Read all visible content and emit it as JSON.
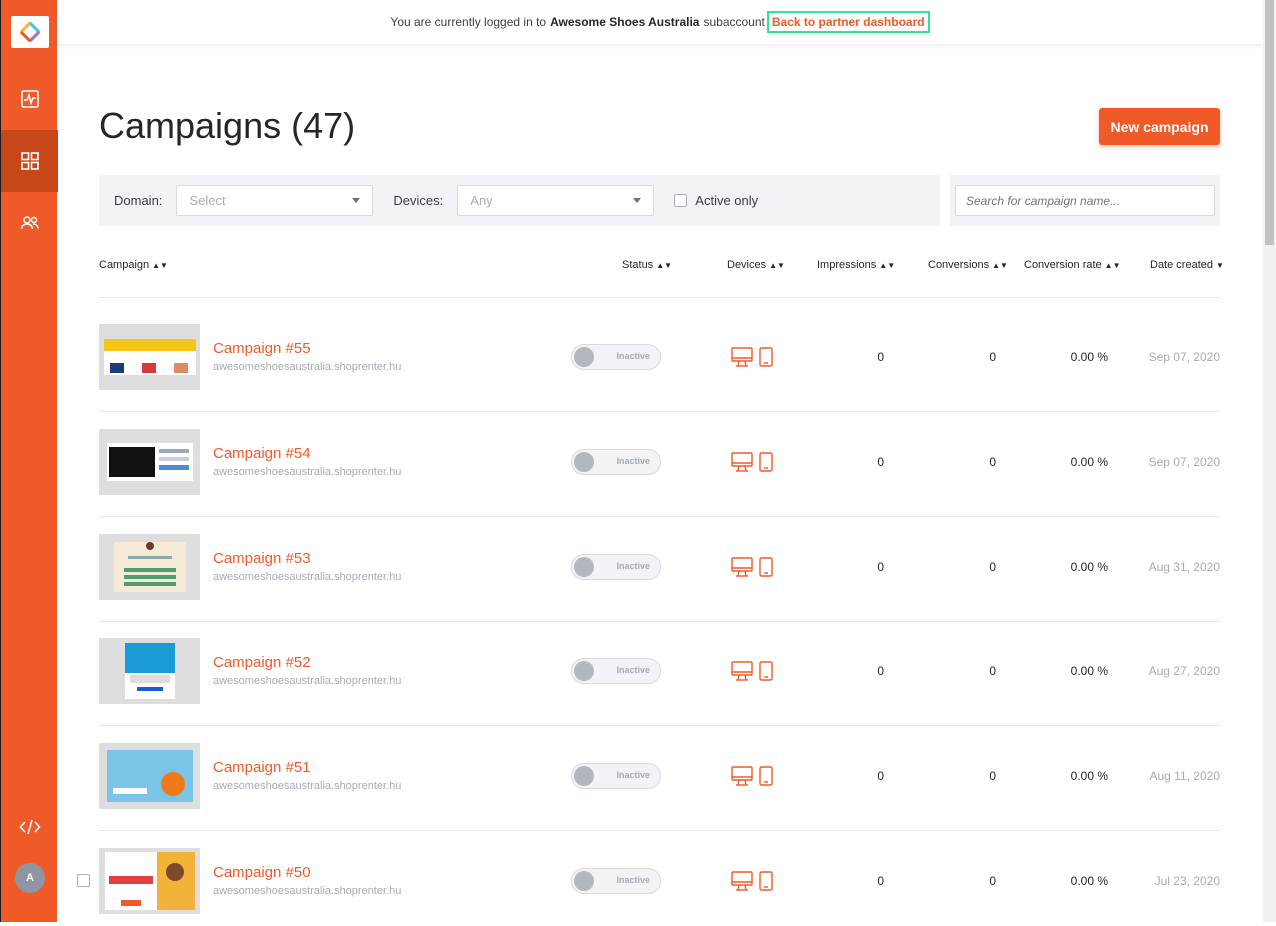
{
  "colors": {
    "accent": "#ef5a28",
    "highlight": "#2fe58f"
  },
  "topbar": {
    "prefix": "You are currently logged in to",
    "account": "Awesome Shoes Australia",
    "suffix": "subaccount",
    "back_link": "Back to partner dashboard"
  },
  "sidebar": {
    "items": [
      {
        "icon": "analytics-icon"
      },
      {
        "icon": "campaigns-grid-icon",
        "active": true
      },
      {
        "icon": "users-icon"
      }
    ],
    "code_icon": "code-icon",
    "avatar_initial": "A"
  },
  "page": {
    "title": "Campaigns (47)",
    "new_button": "New campaign"
  },
  "filters": {
    "domain_label": "Domain:",
    "domain_value": "Select",
    "devices_label": "Devices:",
    "devices_value": "Any",
    "active_only": "Active only",
    "search_placeholder": "Search for campaign name..."
  },
  "columns": {
    "campaign": "Campaign",
    "status": "Status",
    "devices": "Devices",
    "impressions": "Impressions",
    "conversions": "Conversions",
    "conversion_rate": "Conversion rate",
    "date_created": "Date created"
  },
  "rows": [
    {
      "name": "Campaign #55",
      "domain": "awesomeshoesaustralia.shoprenter.hu",
      "status": "Inactive",
      "impressions": "0",
      "conversions": "0",
      "rate": "0.00 %",
      "date": "Sep 07, 2020"
    },
    {
      "name": "Campaign #54",
      "domain": "awesomeshoesaustralia.shoprenter.hu",
      "status": "Inactive",
      "impressions": "0",
      "conversions": "0",
      "rate": "0.00 %",
      "date": "Sep 07, 2020"
    },
    {
      "name": "Campaign #53",
      "domain": "awesomeshoesaustralia.shoprenter.hu",
      "status": "Inactive",
      "impressions": "0",
      "conversions": "0",
      "rate": "0.00 %",
      "date": "Aug 31, 2020"
    },
    {
      "name": "Campaign #52",
      "domain": "awesomeshoesaustralia.shoprenter.hu",
      "status": "Inactive",
      "impressions": "0",
      "conversions": "0",
      "rate": "0.00 %",
      "date": "Aug 27, 2020"
    },
    {
      "name": "Campaign #51",
      "domain": "awesomeshoesaustralia.shoprenter.hu",
      "status": "Inactive",
      "impressions": "0",
      "conversions": "0",
      "rate": "0.00 %",
      "date": "Aug 11, 2020"
    },
    {
      "name": "Campaign #50",
      "domain": "awesomeshoesaustralia.shoprenter.hu",
      "status": "Inactive",
      "impressions": "0",
      "conversions": "0",
      "rate": "0.00 %",
      "date": "Jul 23, 2020"
    }
  ]
}
